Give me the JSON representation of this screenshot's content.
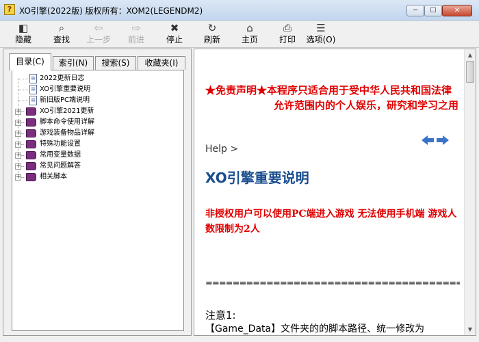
{
  "window": {
    "title": "XO引擎(2022版)  版权所有：XOM2(LEGENDM2)",
    "app_icon": "help-question-icon",
    "min_glyph": "─",
    "max_glyph": "☐",
    "close_glyph": "✕"
  },
  "toolbar": {
    "items": [
      {
        "label": "隐藏",
        "icon": "hide-icon",
        "glyph": "◧",
        "enabled": true
      },
      {
        "label": "查找",
        "icon": "find-icon",
        "glyph": "⌕",
        "enabled": true
      },
      {
        "label": "上一步",
        "icon": "back-arrow-icon",
        "glyph": "⇦",
        "enabled": false
      },
      {
        "label": "前进",
        "icon": "forward-arrow-icon",
        "glyph": "⇨",
        "enabled": false
      },
      {
        "label": "停止",
        "icon": "stop-icon",
        "glyph": "✖",
        "enabled": true
      },
      {
        "label": "刷新",
        "icon": "refresh-icon",
        "glyph": "↻",
        "enabled": true
      },
      {
        "label": "主页",
        "icon": "home-icon",
        "glyph": "⌂",
        "enabled": true
      },
      {
        "label": "打印",
        "icon": "print-icon",
        "glyph": "⎙",
        "enabled": true
      },
      {
        "label": "选项(O)",
        "icon": "options-icon",
        "glyph": "☰",
        "enabled": true
      }
    ]
  },
  "tabs": [
    {
      "label": "目录(C)",
      "active": true
    },
    {
      "label": "索引(N)",
      "active": false
    },
    {
      "label": "搜索(S)",
      "active": false
    },
    {
      "label": "收藏夹(I)",
      "active": false
    }
  ],
  "tree": [
    {
      "label": "2022更新日志",
      "type": "page"
    },
    {
      "label": "XO引擎重要说明",
      "type": "page"
    },
    {
      "label": "新旧版PC端说明",
      "type": "page"
    },
    {
      "label": "XO引擎2021更新",
      "type": "book"
    },
    {
      "label": "脚本命令使用详解",
      "type": "book"
    },
    {
      "label": "游戏装备物品详解",
      "type": "book"
    },
    {
      "label": "特殊功能设置",
      "type": "book"
    },
    {
      "label": "常用变量数据",
      "type": "book"
    },
    {
      "label": "常见问题解答",
      "type": "book"
    },
    {
      "label": "相关脚本",
      "type": "book"
    }
  ],
  "content": {
    "disclaimer_line1": "★免责声明★本程序只适合用于受中华人民共和国法律",
    "disclaimer_line2": "允许范围内的个人娱乐，研究和学习之用",
    "breadcrumb": "Help >",
    "title": "XO引擎重要说明",
    "notice": "非授权用户可以使用PC端进入游戏  无法使用手机端  游戏人数限制为2人",
    "separator": "==========================================================",
    "note_title": "注意1:",
    "note_line": "【Game_Data】文件夹的的脚本路径、统一修改为"
  },
  "colors": {
    "disclaimer": "#e00000",
    "title": "#1a4d8f",
    "nav_arrow": "#3b73c8",
    "book": "#7a2f7d"
  }
}
